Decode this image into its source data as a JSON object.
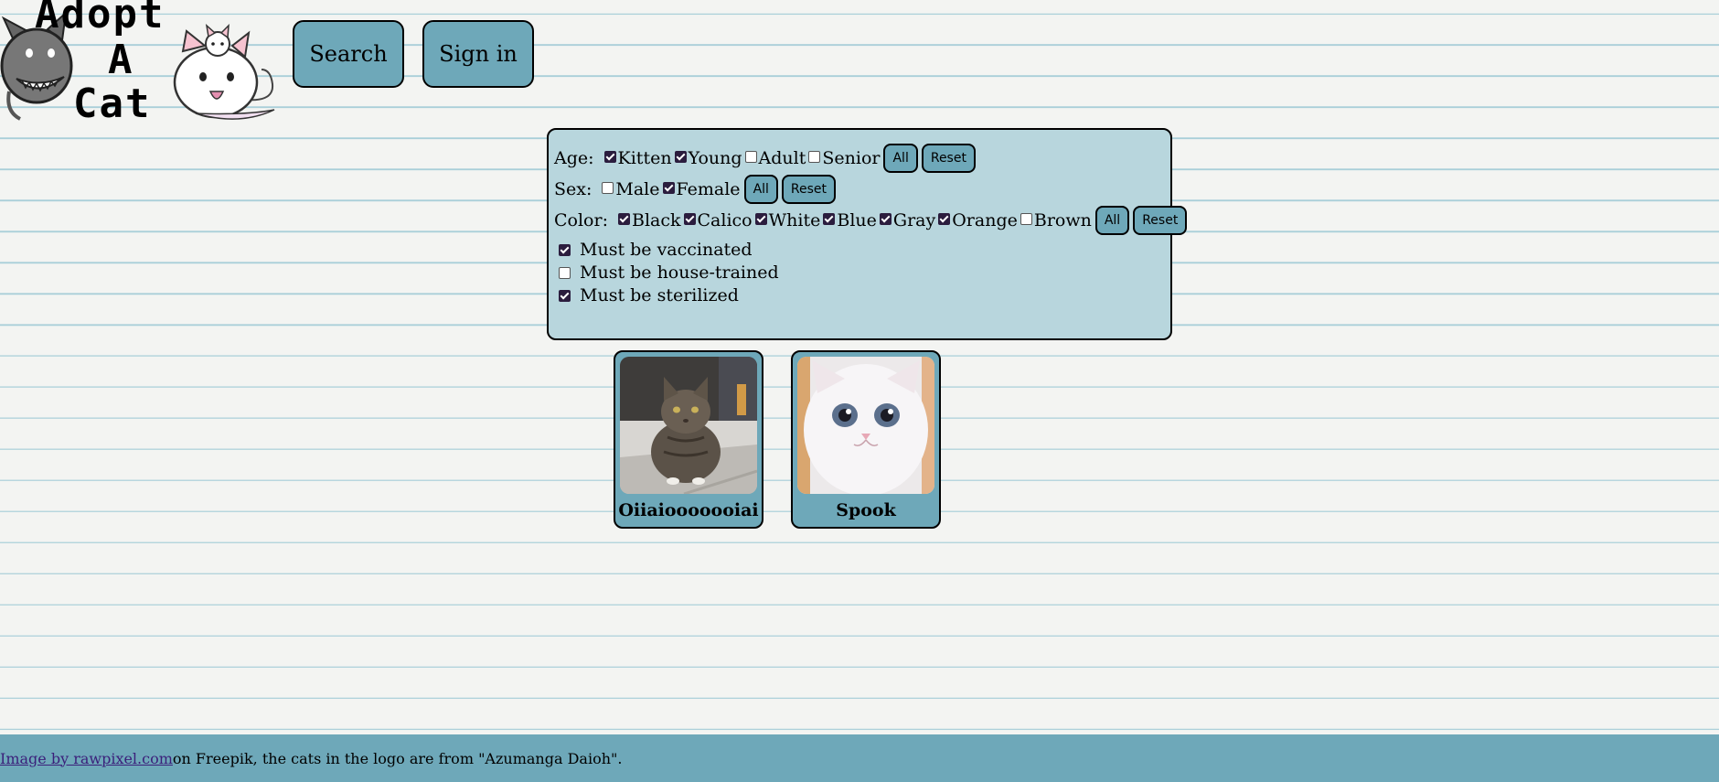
{
  "logo": {
    "text": "Adopt A Cat",
    "lines": [
      "Adopt",
      "A",
      "Cat"
    ]
  },
  "nav": {
    "search_label": "Search",
    "signin_label": "Sign in"
  },
  "filters": {
    "age": {
      "label": "Age:",
      "options": [
        {
          "label": "Kitten",
          "checked": true
        },
        {
          "label": "Young",
          "checked": true
        },
        {
          "label": "Adult",
          "checked": false
        },
        {
          "label": "Senior",
          "checked": false
        }
      ],
      "all_label": "All",
      "reset_label": "Reset"
    },
    "sex": {
      "label": "Sex:",
      "options": [
        {
          "label": "Male",
          "checked": false
        },
        {
          "label": "Female",
          "checked": true
        }
      ],
      "all_label": "All",
      "reset_label": "Reset"
    },
    "color": {
      "label": "Color:",
      "options": [
        {
          "label": "Black",
          "checked": true
        },
        {
          "label": "Calico",
          "checked": true
        },
        {
          "label": "White",
          "checked": true
        },
        {
          "label": "Blue",
          "checked": true
        },
        {
          "label": "Gray",
          "checked": true
        },
        {
          "label": "Orange",
          "checked": true
        },
        {
          "label": "Brown",
          "checked": false
        }
      ],
      "all_label": "All",
      "reset_label": "Reset"
    },
    "requirements": [
      {
        "label": "Must be vaccinated",
        "checked": true
      },
      {
        "label": "Must be house-trained",
        "checked": false
      },
      {
        "label": "Must be sterilized",
        "checked": true
      }
    ]
  },
  "cats": [
    {
      "name": "Oiiaiooooooiai"
    },
    {
      "name": "Spook"
    }
  ],
  "footer": {
    "link_text": "Image by rawpixel.com",
    "text": " on Freepik, the cats in the logo are from \"Azumanga Daioh\"."
  },
  "colors": {
    "accent": "#6ea8b9",
    "panel": "#b8d6dd",
    "page_background": "#f3f4f2",
    "ruled_line": "#a9cfd9",
    "checkbox_checked": "#2b1d3e"
  }
}
